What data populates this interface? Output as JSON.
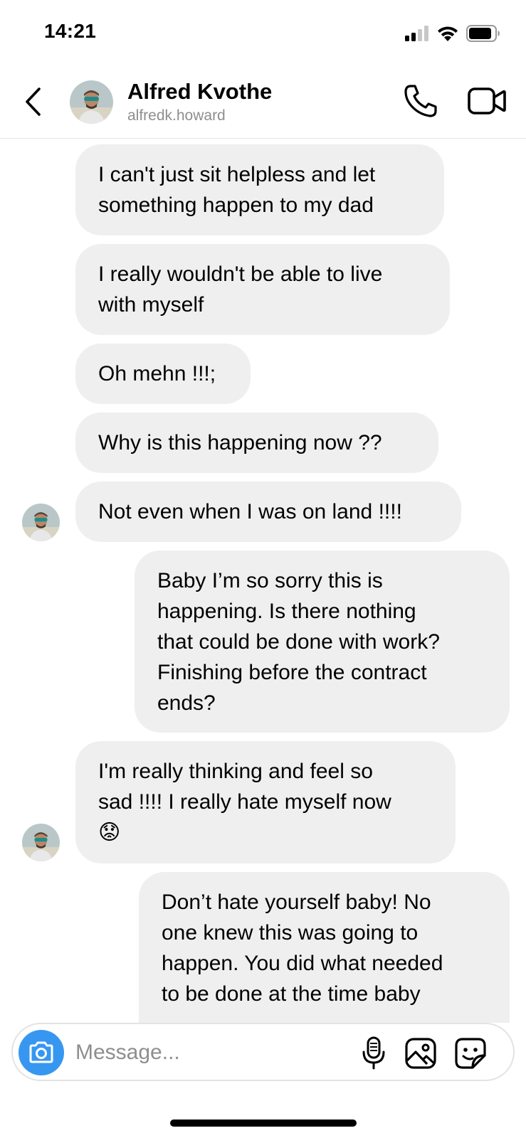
{
  "status_bar": {
    "time": "14:21",
    "icons": [
      "signal-icon",
      "wifi-icon",
      "battery-icon"
    ]
  },
  "header": {
    "back_icon": "chevron-left-icon",
    "contact_name": "Alfred Kvothe",
    "contact_username": "alfredk.howard",
    "call_icon": "phone-icon",
    "video_icon": "video-camera-icon"
  },
  "messages": [
    {
      "sender": "them",
      "lines": [
        "I can't just sit helpless and let",
        "something happen to my dad"
      ]
    },
    {
      "sender": "them",
      "lines": [
        "I really wouldn't be able to live",
        "with myself"
      ]
    },
    {
      "sender": "them",
      "lines": [
        "Oh mehn !!!;"
      ]
    },
    {
      "sender": "them",
      "lines": [
        "Why is this happening now ??"
      ]
    },
    {
      "sender": "them",
      "lines": [
        "Not even when I was on land !!!!"
      ]
    },
    {
      "sender": "me",
      "lines": [
        "Baby I’m so sorry this is",
        "happening. Is there nothing",
        "that could be done with work?",
        "Finishing before the contract",
        "ends?"
      ]
    },
    {
      "sender": "them",
      "lines": [
        "I'm really thinking and feel so",
        "sad !!!! I really hate myself now",
        "😟"
      ]
    },
    {
      "sender": "me",
      "lines": [
        "Don’t hate yourself baby! No",
        "one knew this was going to",
        "happen. You did what needed",
        "to be done at the time baby"
      ]
    }
  ],
  "composer": {
    "camera_icon": "camera-icon",
    "placeholder": "Message...",
    "value": "",
    "mic_icon": "microphone-icon",
    "gallery_icon": "image-icon",
    "sticker_icon": "sticker-icon"
  },
  "colors": {
    "bubble": "#efefef",
    "accent": "#3797f0",
    "muted_text": "#8e8e8e"
  }
}
